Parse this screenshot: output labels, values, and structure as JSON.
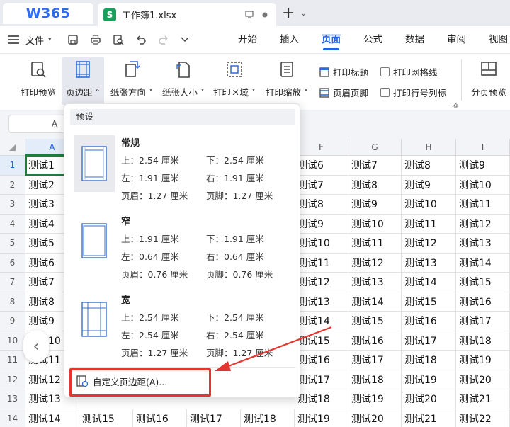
{
  "titlebar": {
    "logo": "W365",
    "doc_title": "工作簿1.xlsx",
    "doc_icon_letter": "S"
  },
  "menubar": {
    "file_label": "文件",
    "tabs": [
      "开始",
      "插入",
      "页面",
      "公式",
      "数据",
      "审阅",
      "视图"
    ],
    "active_tab": "页面"
  },
  "ribbon": {
    "print_preview": "打印预览",
    "margins": "页边距",
    "orientation": "纸张方向",
    "paper_size": "纸张大小",
    "print_area": "打印区域",
    "print_scaling": "打印缩放",
    "print_titles": "打印标题",
    "header_footer": "页眉页脚",
    "print_gridlines": "打印网格线",
    "print_row_col_labels": "打印行号列标",
    "page_break_preview": "分页预览"
  },
  "namebox": "A",
  "columns": [
    "A",
    "",
    "",
    "",
    "",
    "F",
    "G",
    "H",
    "I"
  ],
  "rows": [
    "1",
    "2",
    "3",
    "4",
    "5",
    "6",
    "7",
    "8",
    "9",
    "10",
    "11",
    "12",
    "13",
    "14"
  ],
  "col_a": [
    "测试1",
    "测试2",
    "测试3",
    "测试4",
    "测试5",
    "测试6",
    "测试7",
    "测试8",
    "测试9",
    "测试10",
    "测试11",
    "测试12",
    "测试13",
    "测试14"
  ],
  "col_b_row14": [
    "测试14",
    "测试15"
  ],
  "col_c_row14": "测试16",
  "col_d_row14": "测试17",
  "col_e_row14": "测试18",
  "col_f": [
    "测试6",
    "测试7",
    "测试8",
    "测试9",
    "测试10",
    "测试11",
    "测试12",
    "测试13",
    "测试14",
    "测试15",
    "测试16",
    "测试17",
    "测试18",
    "测试19"
  ],
  "col_g": [
    "测试7",
    "测试8",
    "测试9",
    "测试10",
    "测试11",
    "测试12",
    "测试13",
    "测试14",
    "测试15",
    "测试16",
    "测试17",
    "测试18",
    "测试19",
    "测试20"
  ],
  "col_h": [
    "测试8",
    "测试9",
    "测试10",
    "测试11",
    "测试12",
    "测试13",
    "测试14",
    "测试15",
    "测试16",
    "测试17",
    "测试18",
    "测试19",
    "测试20",
    "测试21"
  ],
  "col_i": [
    "测试9",
    "测试10",
    "测试11",
    "测试12",
    "测试13",
    "测试14",
    "测试15",
    "测试16",
    "测试17",
    "测试18",
    "测试19",
    "测试20",
    "测试21",
    "测试22"
  ],
  "dropdown": {
    "header": "预设",
    "presets": [
      {
        "name": "常规",
        "top": "上：2.54 厘米",
        "bottom": "下：2.54 厘米",
        "left": "左：1.91 厘米",
        "right": "右：1.91 厘米",
        "header": "页眉：1.27 厘米",
        "footer": "页脚：1.27 厘米"
      },
      {
        "name": "窄",
        "top": "上：1.91 厘米",
        "bottom": "下：1.91 厘米",
        "left": "左：0.64 厘米",
        "right": "右：0.64 厘米",
        "header": "页眉：0.76 厘米",
        "footer": "页脚：0.76 厘米"
      },
      {
        "name": "宽",
        "top": "上：2.54 厘米",
        "bottom": "下：2.54 厘米",
        "left": "左：2.54 厘米",
        "right": "右：2.54 厘米",
        "header": "页眉：1.27 厘米",
        "footer": "页脚：1.27 厘米"
      }
    ],
    "custom": "自定义页边距(A)..."
  },
  "colors": {
    "accent": "#1e64e6",
    "selection": "#1e7d3a",
    "annotation": "#e5352e"
  }
}
